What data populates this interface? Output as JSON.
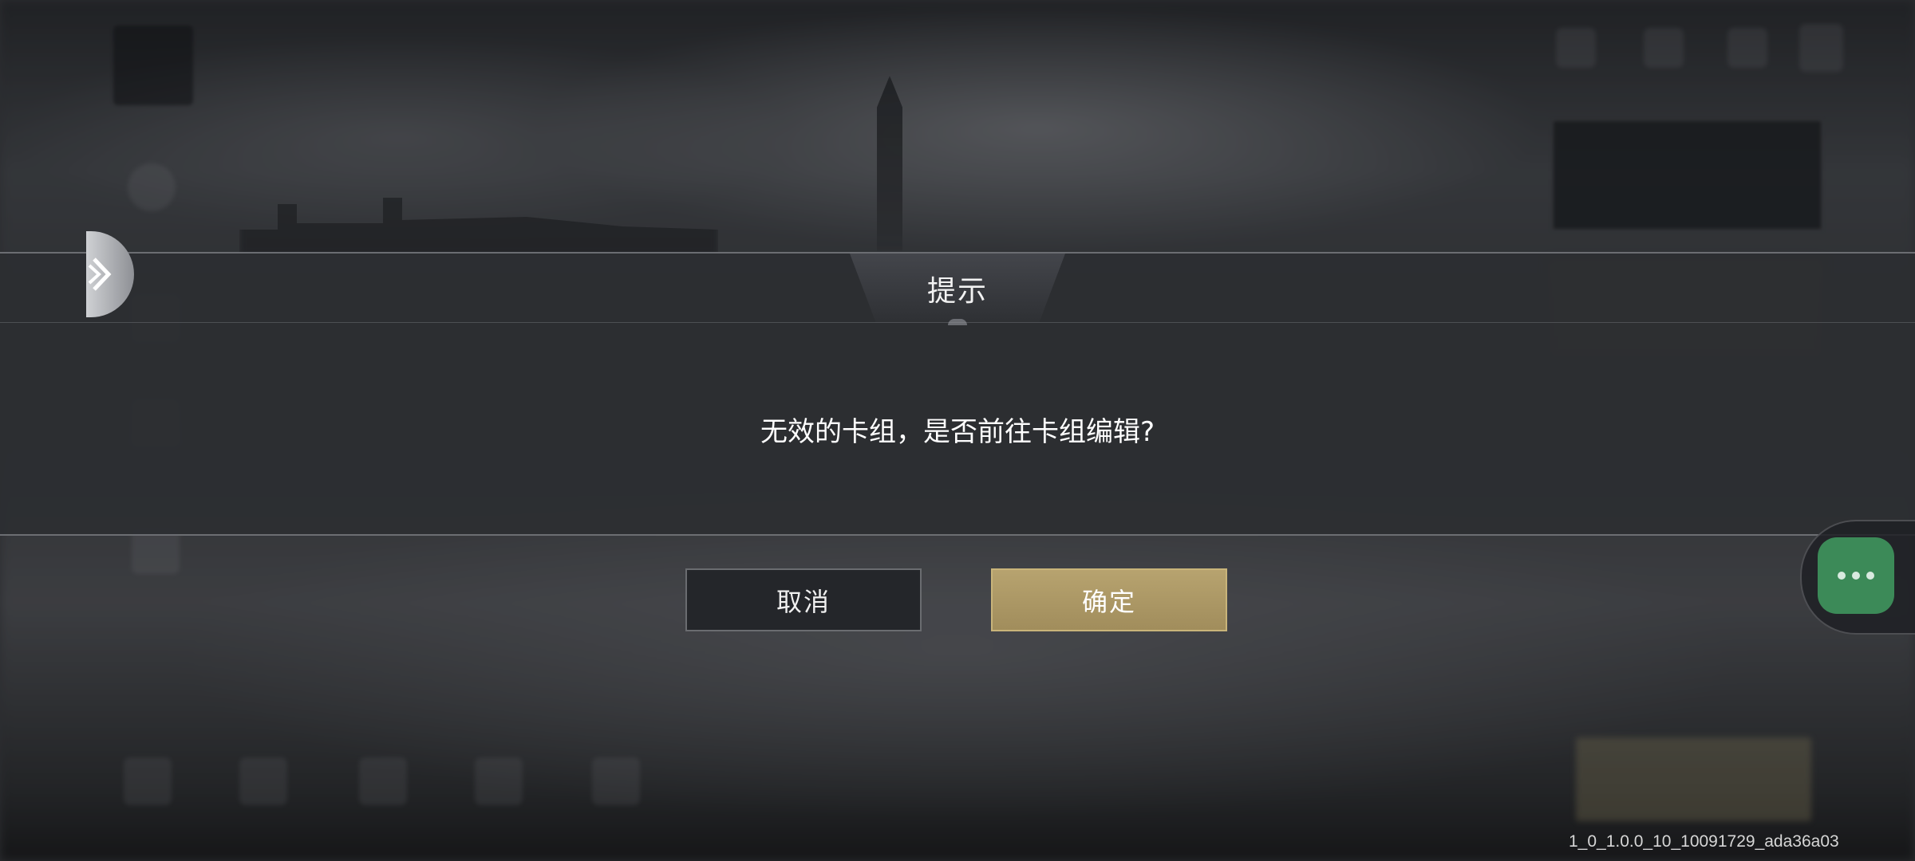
{
  "dialog": {
    "title": "提示",
    "message": "无效的卡组，是否前往卡组编辑?",
    "cancel_label": "取消",
    "confirm_label": "确定"
  },
  "version_text": "1_0_1.0.0_10_10091729_ada36a03",
  "icons": {
    "side_toggle": "chevron-right-icon",
    "float_menu": "more-dots-icon"
  },
  "colors": {
    "confirm_button": "#b7a36f",
    "cancel_button": "#24262a",
    "float_button": "#3c8a58"
  }
}
